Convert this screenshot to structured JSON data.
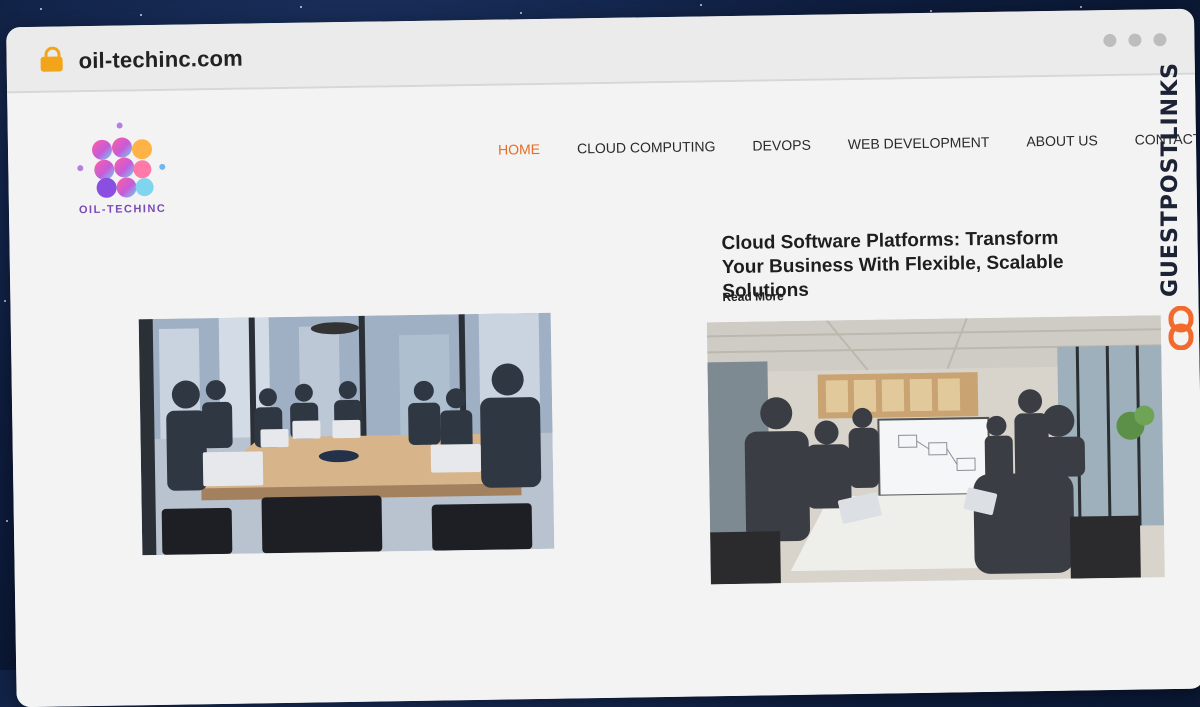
{
  "browser": {
    "url": "oil-techinc.com"
  },
  "brand": {
    "name": "OIL-TECHINC"
  },
  "nav": {
    "items": [
      {
        "label": "HOME",
        "active": true
      },
      {
        "label": "CLOUD COMPUTING",
        "active": false
      },
      {
        "label": "DEVOPS",
        "active": false
      },
      {
        "label": "WEB DEVELOPMENT",
        "active": false
      },
      {
        "label": "ABOUT US",
        "active": false
      },
      {
        "label": "CONTACT US",
        "active": false
      }
    ]
  },
  "article": {
    "headline": "Cloud Software Platforms: Transform Your Business With Flexible, Scalable Solutions",
    "read_more": "Read More"
  },
  "watermark": {
    "text": "GUESTPOSTLINKS"
  },
  "colors": {
    "accent": "#e56d24",
    "watermark_text": "#1c2335",
    "watermark_icon": "#f26b2c"
  },
  "images": {
    "left": "office-meeting-photo",
    "right": "team-collaboration-photo"
  }
}
